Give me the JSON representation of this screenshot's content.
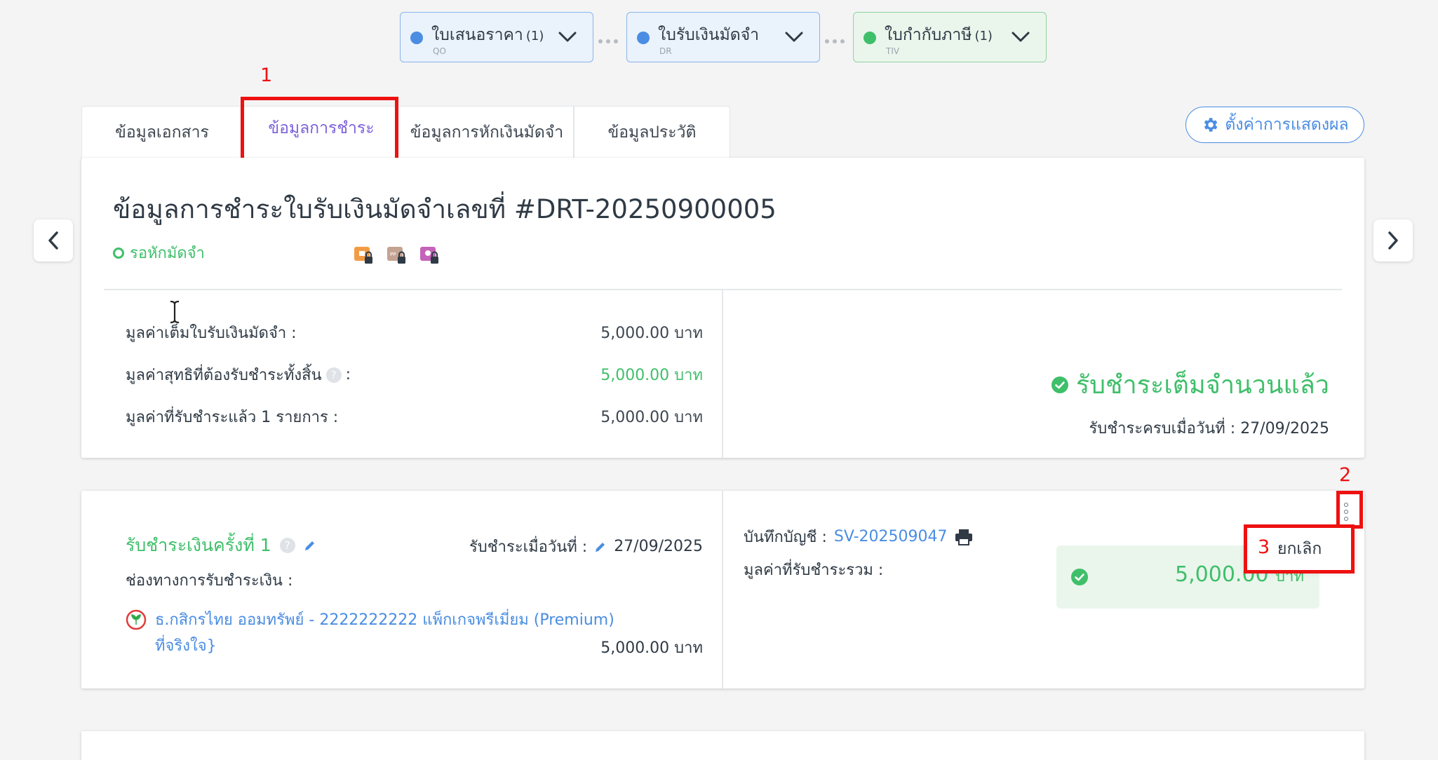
{
  "pipeline": [
    {
      "title": "ใบเสนอราคา",
      "count": "(1)",
      "code": "QO",
      "color": "#4a8de3"
    },
    {
      "title": "ใบรับเงินมัดจำ",
      "count": "",
      "code": "DR",
      "color": "#4a8de3"
    },
    {
      "title": "ใบกำกับภาษี",
      "count": "(1)",
      "code": "TIV",
      "color": "#3fbf6a"
    }
  ],
  "tabs": [
    "ข้อมูลเอกสาร",
    "ข้อมูลการชำระ",
    "ข้อมูลการหักเงินมัดจำ",
    "ข้อมูลประวัติ"
  ],
  "active_tab": "ข้อมูลการชำระ",
  "settings_label": "ตั้งค่าการแสดงผล",
  "summary": {
    "title": "ข้อมูลการชำระใบรับเงินมัดจำเลขที่ #DRT-20250900005",
    "status": "รอหักมัดจำ",
    "rows": [
      {
        "label": "มูลค่าเต็มใบรับเงินมัดจำ :",
        "value": "5,000.00 บาท"
      },
      {
        "label": "มูลค่าสุทธิที่ต้องรับชำระทั้งสิ้น",
        "label_suffix": ":",
        "value": "5,000.00 บาท"
      },
      {
        "label": "มูลค่าที่รับชำระแล้ว 1 รายการ :",
        "value": "5,000.00 บาท"
      }
    ],
    "paid_status": "รับชำระเต็มจำนวนแล้ว",
    "paid_date_label": "รับชำระครบเมื่อวันที่ :",
    "paid_date": "27/09/2025"
  },
  "payment": {
    "title": "รับชำระเงินครั้งที่ 1",
    "date_label": "รับชำระเมื่อวันที่ :",
    "date": "27/09/2025",
    "channel_label": "ช่องทางการรับชำระเงิน :",
    "bank_line1": "ธ.กสิกรไทย ออมทรัพย์ - 2222222222 แพ็กเกจพรีเมี่ยม (Premium)",
    "bank_line2": "ที่จริงใจ}",
    "bank_amount": "5,000.00 บาท",
    "ledger_label": "บันทึกบัญชี :",
    "ledger_no": "SV-202509047",
    "total_label": "มูลค่าที่รับชำระรวม :",
    "total_amount": "5,000.00",
    "total_currency": "บาท"
  },
  "menu": {
    "cancel": "ยกเลิก"
  },
  "annotations": [
    "1",
    "2",
    "3"
  ]
}
